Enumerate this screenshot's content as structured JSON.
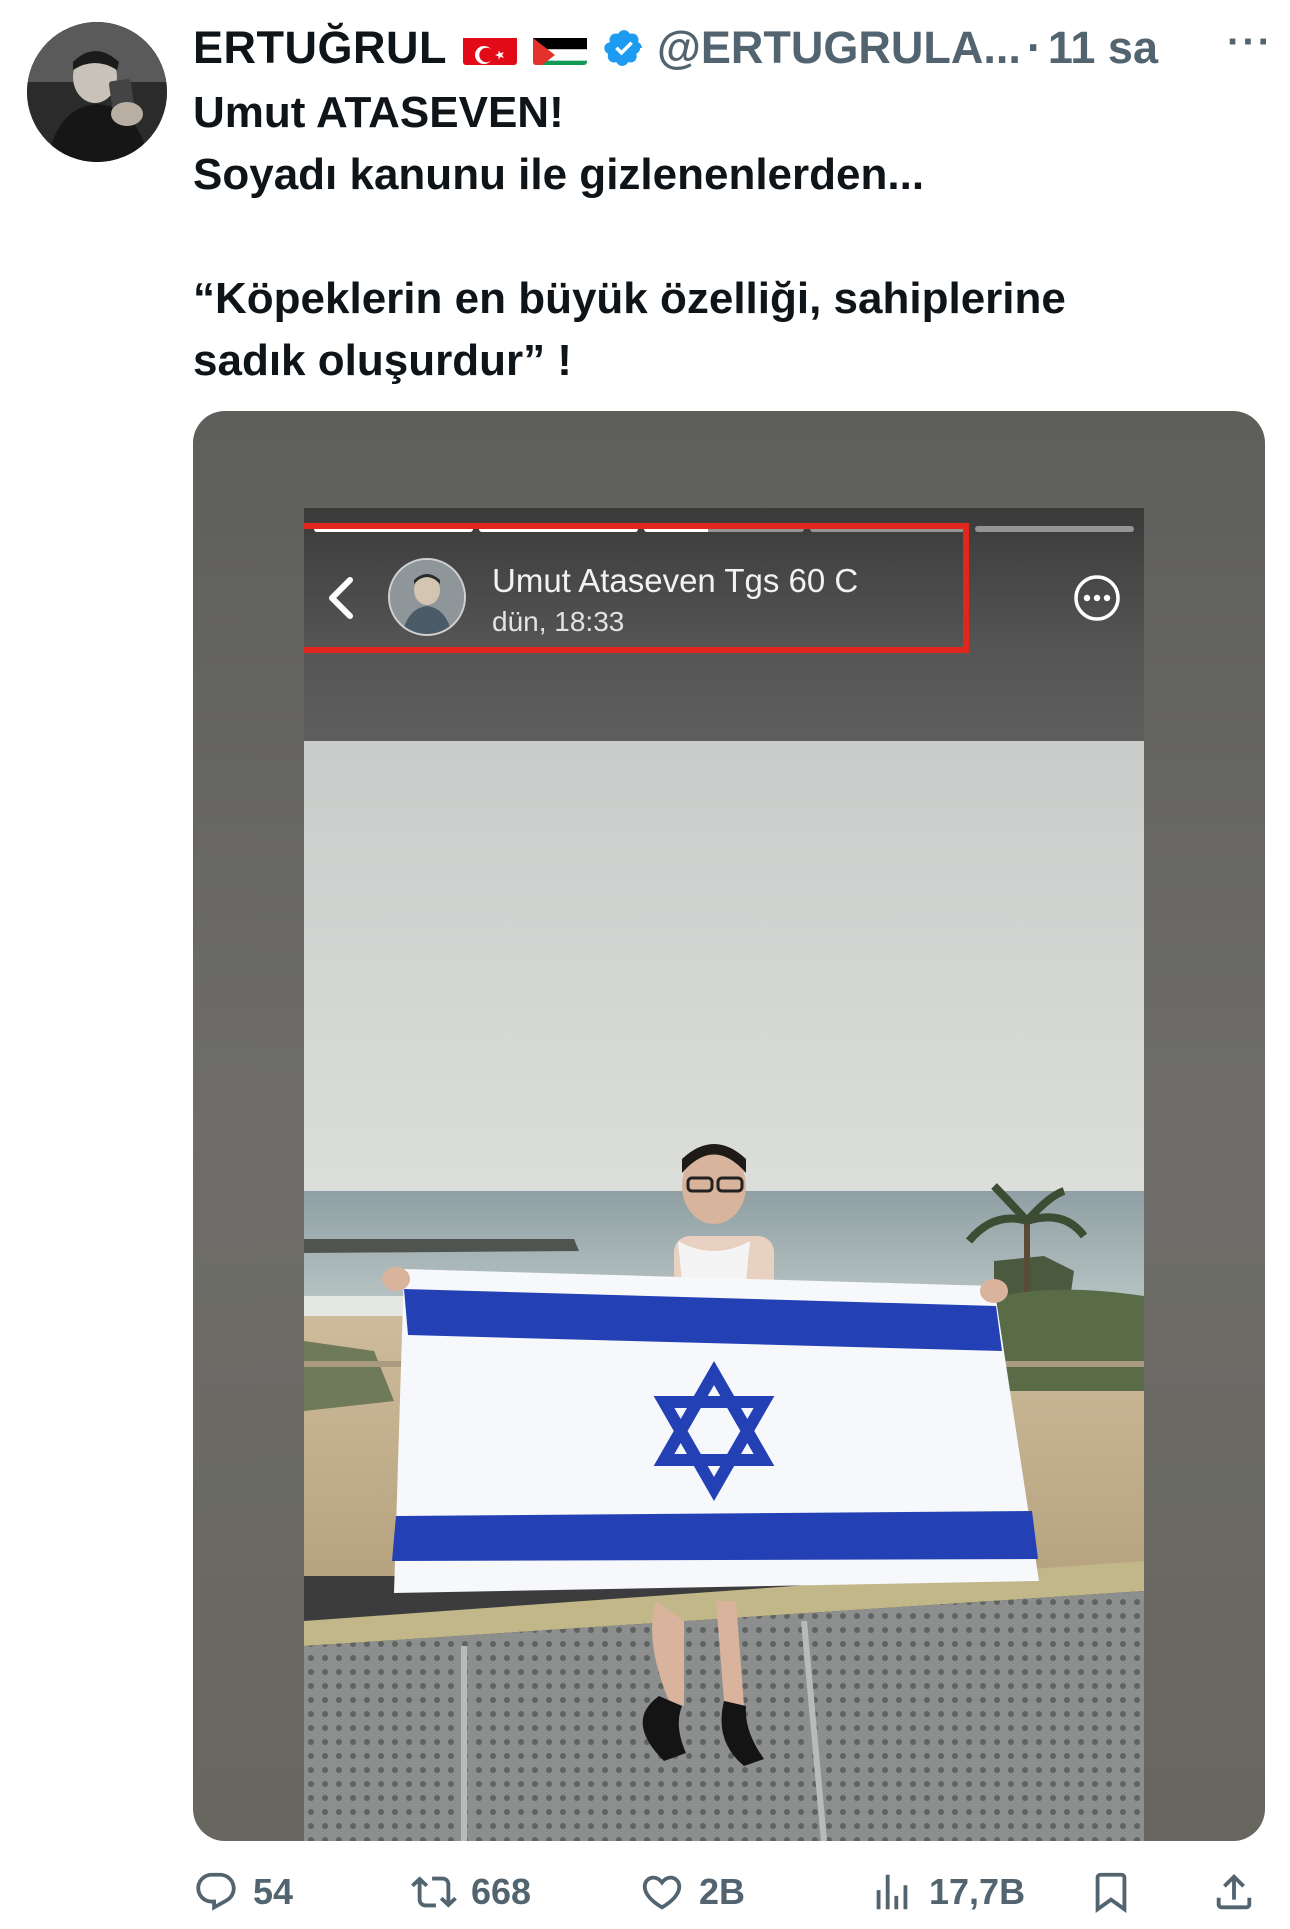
{
  "tweet": {
    "display_name": "ERTUĞRUL",
    "handle": "@ERTUGRULA...",
    "separator": "·",
    "time": "11 sa",
    "more_label": "···",
    "lines": [
      "Umut ATASEVEN!",
      "Soyadı kanunu ile gizlenenlerden...",
      "",
      "“Köpeklerin en büyük özelliği, sahiplerine",
      "sadık oluşurdur” !"
    ]
  },
  "story": {
    "username": "Umut Ataseven Tgs 60 C",
    "timestamp": "dün, 18:33",
    "progress": [
      1.0,
      1.0,
      0.4,
      0.0,
      0.0
    ],
    "highlight_color": "#e3261b"
  },
  "actions": {
    "replies": "54",
    "retweets": "668",
    "likes": "2B",
    "views": "17,7B"
  },
  "colors": {
    "text": "#0f1419",
    "secondary": "#536471",
    "verified": "#1d9bf0"
  }
}
